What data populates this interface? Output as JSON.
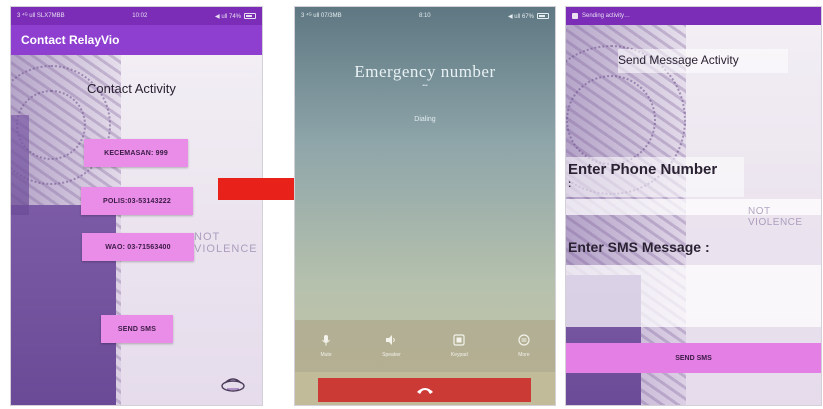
{
  "phone1": {
    "status_left": "3 ⁴ᴳ ull SLX7MBB",
    "status_time": "10:02",
    "status_right": "◀ ull 74%",
    "app_title": "Contact RelayVio",
    "activity_title": "Contact Activity",
    "buttons": [
      {
        "label": "KECEMASAN: 999"
      },
      {
        "label": "POLIS:03-53143222"
      },
      {
        "label": "WAO: 03-71563400"
      },
      {
        "label": "SEND SMS"
      }
    ],
    "ghost_text": "NOT VIOLENCE"
  },
  "phone2": {
    "status_left": "3 ⁴ᴳ ull 07/3MB",
    "status_time": "8:10",
    "status_right": "◀ ull 67%",
    "call_title": "Emergency number",
    "call_sub": "•••",
    "call_status": "Dialing",
    "controls": [
      {
        "label": "Mute",
        "icon": "mic-icon"
      },
      {
        "label": "Speaker",
        "icon": "speaker-icon"
      },
      {
        "label": "Keypad",
        "icon": "keypad-icon"
      },
      {
        "label": "More",
        "icon": "more-icon"
      }
    ]
  },
  "phone3": {
    "status_left": "Sending activity…",
    "activity_title": "Send Message Activity",
    "phone_label": "Enter Phone Number",
    "phone_colon": ":",
    "phone_value": "",
    "sms_label": "Enter SMS Message :",
    "sms_value": "",
    "send_label": "SEND SMS",
    "ghost_text": "NOT VIOLENCE"
  },
  "colors": {
    "status_bar": "#7b2db8",
    "app_bar": "#8e3fd0",
    "pink_button": "#e98de8",
    "end_call": "#cc3a36",
    "arrow": "#e8211b"
  }
}
